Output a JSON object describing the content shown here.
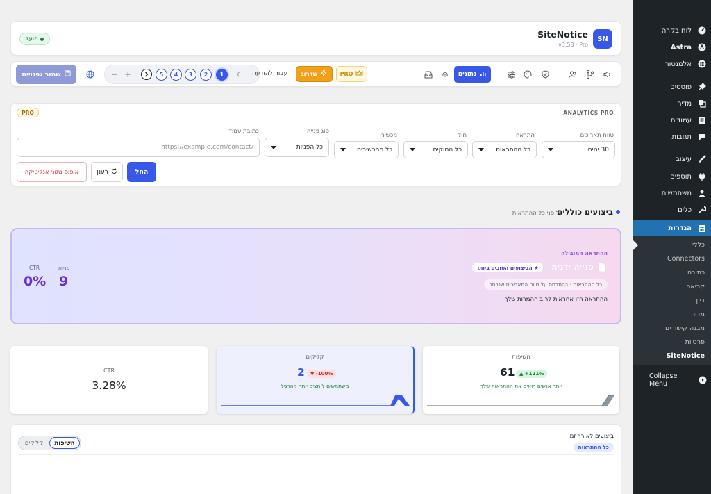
{
  "sidebar": {
    "items": [
      {
        "label": "לוח בקרה",
        "icon": "dashboard-icon"
      },
      {
        "label": "Astra",
        "icon": "astra-icon"
      },
      {
        "label": "אלמנטור",
        "icon": "elementor-icon"
      },
      {
        "label": "פוסטים",
        "icon": "pin-icon"
      },
      {
        "label": "מדיה",
        "icon": "media-icon"
      },
      {
        "label": "עמודים",
        "icon": "pages-icon"
      },
      {
        "label": "תגובות",
        "icon": "comments-icon"
      },
      {
        "label": "עיצוב",
        "icon": "appearance-icon"
      },
      {
        "label": "תוספים",
        "icon": "plugins-icon"
      },
      {
        "label": "משתמשים",
        "icon": "users-icon"
      },
      {
        "label": "כלים",
        "icon": "tools-icon"
      },
      {
        "label": "הגדרות",
        "icon": "settings-icon"
      }
    ],
    "submenu": [
      "כללי",
      "Connectors",
      "כתיבה",
      "קריאה",
      "דיון",
      "מדיה",
      "מבנה קישורים",
      "פרטיות",
      "SiteNotice"
    ],
    "collapse_label": "Collapse Menu"
  },
  "header": {
    "logo_text": "SN",
    "title": "SiteNotice",
    "version": "v3.53 · Pro",
    "status": "פועל"
  },
  "toolbar": {
    "save_label": "שמור שינויים",
    "steps": [
      "5",
      "4",
      "3",
      "2",
      "1"
    ],
    "goto_label": "עבור להודעה",
    "upgrade_label": "שדרוג",
    "pro_label": "PRO",
    "stats_label": "נתונים"
  },
  "analytics": {
    "title": "ANALYTICS PRO",
    "pro_badge": "PRO",
    "filters": [
      {
        "label": "טווח תאריכים",
        "value": "30 ימים"
      },
      {
        "label": "התראה",
        "value": "כל ההתראות"
      },
      {
        "label": "חוק",
        "value": "כל החוקים"
      },
      {
        "label": "מכשיר",
        "value": "כל המכשירים"
      },
      {
        "label": "סוג פנייה",
        "value": "כל הפניות"
      }
    ],
    "url_label": "כתובת עמוד",
    "url_placeholder": "https://example.com/contact/",
    "apply_label": "החל",
    "refresh_label": "רענן",
    "reset_label": "איפוס נתוני אנליטיקה"
  },
  "overall": {
    "title": "ביצועים כוללים",
    "subtitle": "על פני כל ההתראות"
  },
  "leader": {
    "eyebrow": "ההתראה המובילה",
    "name": "פנייה ידנית",
    "badge": "★ הביצועים הטובים ביותר",
    "sub": "כל ההתראות · בהתבסס על טווח התאריכים שנבחר",
    "desc": "ההתראה הזו אחראית לרוב ההמרות שלך",
    "stat1_label": "פניות",
    "stat1_value": "9",
    "stat2_label": "CTR",
    "stat2_value": "0%"
  },
  "stats": {
    "impressions": {
      "label": "חשיפות",
      "value": "61",
      "delta": "▲ +121%",
      "note": "יותר אנשים רואים את ההתראות שלך"
    },
    "clicks": {
      "label": "קליקים",
      "value": "2",
      "delta": "▼ -100%",
      "note": "משתמשים לוחצים יותר מהרגיל"
    },
    "ctr": {
      "label": "CTR",
      "value": "3.28%"
    }
  },
  "timeline": {
    "title": "ביצועים לאורך זמן",
    "badge": "כל ההתראות",
    "tab_impressions": "חשיפות",
    "tab_clicks": "קליקים"
  },
  "colors": {
    "accent": "#3858e9",
    "sidebar": "#1d2327",
    "wp_blue": "#2271b1",
    "orange": "#f0a019",
    "purple": "#6b2fd6"
  }
}
